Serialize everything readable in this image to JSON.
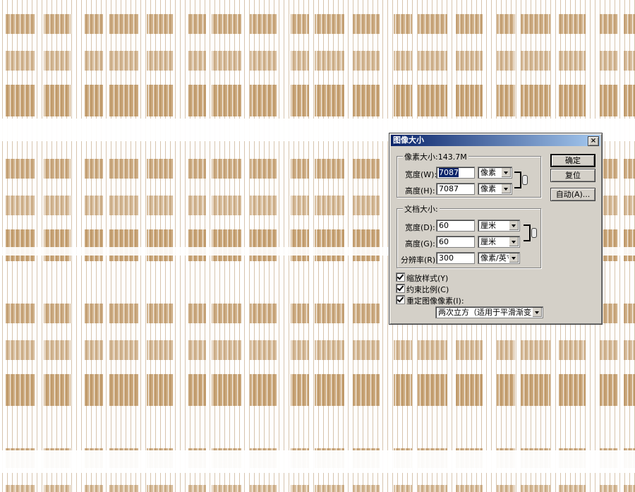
{
  "dialog": {
    "title": "图像大小",
    "close_glyph": "×",
    "pixel_dimensions": {
      "label": "像素大小:143.7M",
      "width_label": "宽度(W):",
      "width_value": "7087",
      "width_unit": "像素",
      "height_label": "高度(H):",
      "height_value": "7087",
      "height_unit": "像素"
    },
    "document_size": {
      "label": "文档大小:",
      "width_label": "宽度(D):",
      "width_value": "60",
      "width_unit": "厘米",
      "height_label": "高度(G):",
      "height_value": "60",
      "height_unit": "厘米",
      "resolution_label": "分辨率(R):",
      "resolution_value": "300",
      "resolution_unit": "像素/英寸"
    },
    "buttons": {
      "ok": "确定",
      "reset": "复位",
      "auto": "自动(A)..."
    },
    "checkboxes": {
      "scale_styles": "缩放样式(Y)",
      "constrain": "约束比例(C)",
      "resample": "重定图像像素(I):"
    },
    "resample_method": "两次立方（适用于平滑渐变）"
  }
}
